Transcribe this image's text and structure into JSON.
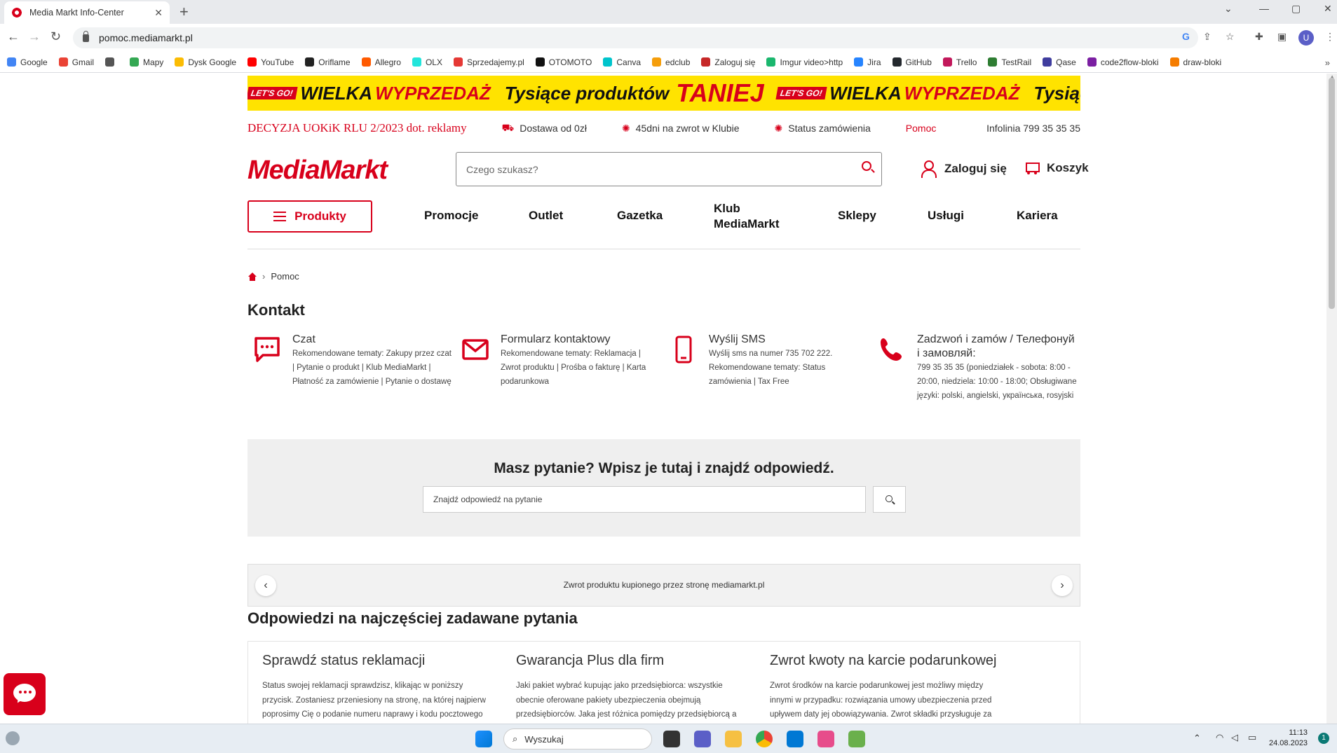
{
  "browser": {
    "tab_title": "Media Markt Info-Center",
    "tab_close": "✕",
    "new_tab": "+",
    "url": "pomoc.mediamarkt.pl",
    "profile_initial": "U",
    "win_min": "—",
    "win_max": "▢",
    "win_close": "✕",
    "win_more": "⌄",
    "bookmarks_more": "»",
    "bookmarks": [
      {
        "label": "Google",
        "color": "#4285f4"
      },
      {
        "label": "Gmail",
        "color": "#ea4335"
      },
      {
        "label": "",
        "color": "#555555"
      },
      {
        "label": "Mapy",
        "color": "#34a853"
      },
      {
        "label": "Dysk Google",
        "color": "#fbbc04"
      },
      {
        "label": "YouTube",
        "color": "#ff0000"
      },
      {
        "label": "Oriflame",
        "color": "#222222"
      },
      {
        "label": "Allegro",
        "color": "#ff5a00"
      },
      {
        "label": "OLX",
        "color": "#23e5db"
      },
      {
        "label": "Sprzedajemy.pl",
        "color": "#e53935"
      },
      {
        "label": "OTOMOTO",
        "color": "#111111"
      },
      {
        "label": "Canva",
        "color": "#00c4cc"
      },
      {
        "label": "edclub",
        "color": "#f59e0b"
      },
      {
        "label": "Zaloguj się",
        "color": "#c62828"
      },
      {
        "label": "Imgur video>http",
        "color": "#1bb76e"
      },
      {
        "label": "Jira",
        "color": "#2684ff"
      },
      {
        "label": "GitHub",
        "color": "#24292e"
      },
      {
        "label": "Trello",
        "color": "#c2185b"
      },
      {
        "label": "TestRail",
        "color": "#2e7d32"
      },
      {
        "label": "Qase",
        "color": "#3f3d9e"
      },
      {
        "label": "code2flow-bloki",
        "color": "#7b1fa2"
      },
      {
        "label": "draw-bloki",
        "color": "#f57c00"
      }
    ]
  },
  "banner": {
    "badge": "LET'S GO!",
    "wielka": "WIELKA",
    "wyprzedaz": "WYPRZEDAŻ",
    "tysiace": "Tysiące produktów",
    "taniej": "TANIEJ"
  },
  "topinfo": {
    "decyzja": "DECYZJA UOKiK RLU 2/2023 dot. reklamy",
    "dostawa": "Dostawa od 0zł",
    "zwrot": "45dni na zwrot w Klubie",
    "status": "Status zamówienia",
    "pomoc": "Pomoc",
    "infolinia": "Infolinia 799 35 35 35"
  },
  "header": {
    "logo": "MediaMarkt",
    "search_placeholder": "Czego szukasz?",
    "login": "Zaloguj się",
    "cart": "Koszyk"
  },
  "nav": {
    "produkty": "Produkty",
    "items": [
      "Promocje",
      "Outlet",
      "Gazetka",
      "Klub MediaMarkt",
      "Sklepy",
      "Usługi",
      "Kariera"
    ]
  },
  "breadcrumb": {
    "sep": "›",
    "current": "Pomoc"
  },
  "kontakt": {
    "title": "Kontakt",
    "items": [
      {
        "title": "Czat",
        "text": "Rekomendowane tematy: Zakupy przez czat | Pytanie o produkt | Klub MediaMarkt | Płatność za zamówienie | Pytanie o dostawę"
      },
      {
        "title": "Formularz kontaktowy",
        "text": "Rekomendowane tematy: Reklamacja | Zwrot produktu | Prośba o fakturę | Karta podarunkowa"
      },
      {
        "title": "Wyślij SMS",
        "text": "Wyślij sms na numer 735 702 222. Rekomendowane tematy: Status zamówienia | Tax Free"
      },
      {
        "title": "Zadzwoń i zamów / Телефонуй і замовляй:",
        "text": "799 35 35 35 (poniedziałek - sobota: 8:00 - 20:00, niedziela: 10:00 - 18:00; Obsługiwane języki: polski, angielski, українська, rosyjski"
      }
    ]
  },
  "faq_search": {
    "question": "Masz pytanie? Wpisz je tutaj i znajdź odpowiedź.",
    "placeholder": "Znajdź odpowiedź na pytanie"
  },
  "carousel": {
    "prev": "‹",
    "next": "›",
    "text": "Zwrot produktu kupionego przez stronę mediamarkt.pl"
  },
  "faq": {
    "title": "Odpowiedzi na najczęściej zadawane pytania",
    "items": [
      {
        "title": "Sprawdź status reklamacji",
        "text": "Status swojej reklamacji sprawdzisz, klikając w poniższy przycisk. Zostaniesz przeniesiony na stronę, na której najpierw poprosimy Cię o podanie numeru naprawy i kodu pocztowego"
      },
      {
        "title": "Gwarancja Plus dla firm",
        "text": "Jaki pakiet wybrać kupując jako przedsiębiorca: wszystkie obecnie oferowane pakiety ubezpieczenia obejmują przedsiębiorców. Jaka jest różnica pomiędzy przedsiębiorcą a"
      },
      {
        "title": "Zwrot kwoty na karcie podarunkowej",
        "text": "Zwrot środków na karcie podarunkowej jest możliwy między innymi w przypadku: rozwiązania umowy ubezpieczenia przed upływem daty jej obowiązywania. Zwrot składki przysługuje za"
      }
    ]
  },
  "taskbar": {
    "search": "Wyszukaj",
    "time": "11:13",
    "date": "24.08.2023",
    "notif": "1"
  }
}
